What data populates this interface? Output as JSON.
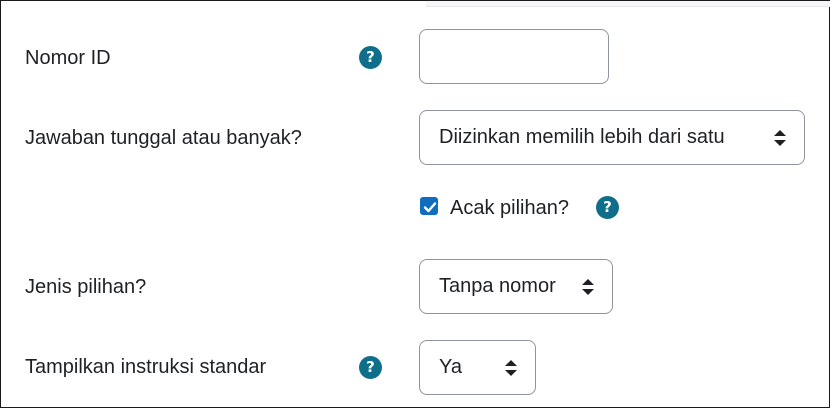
{
  "form": {
    "id_number": {
      "label": "Nomor ID",
      "value": "",
      "help_icon": "question-icon"
    },
    "single_multiple": {
      "label": "Jawaban tunggal atau banyak?",
      "selected": "Diizinkan memilih lebih dari satu"
    },
    "shuffle": {
      "label": "Acak pilihan?",
      "checked": true,
      "help_icon": "question-icon"
    },
    "numbering": {
      "label": "Jenis pilihan?",
      "selected": "Tanpa nomor"
    },
    "show_instructions": {
      "label": "Tampilkan instruksi standar",
      "selected": "Ya",
      "help_icon": "question-icon"
    },
    "help_glyph": "?"
  },
  "colors": {
    "help_icon_bg": "#0f6f8a",
    "checkbox_bg": "#0f6cbf",
    "field_border": "#8f959e",
    "text": "#1d2125"
  }
}
